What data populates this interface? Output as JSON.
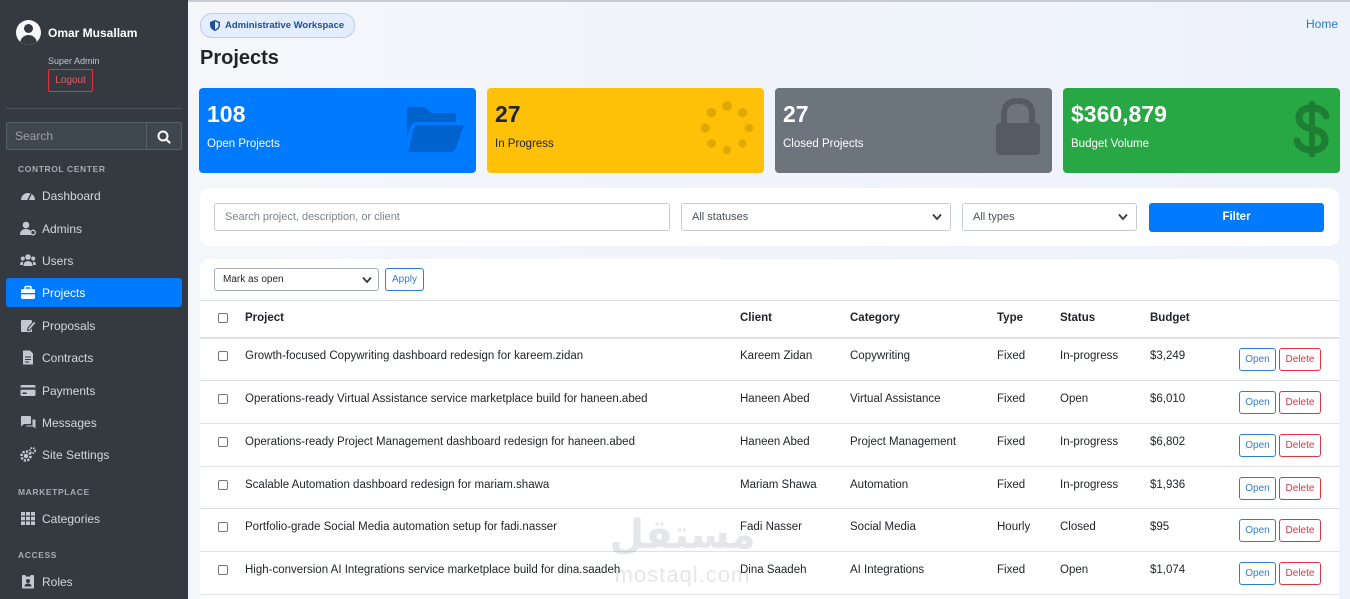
{
  "sidebar": {
    "user_name": "Omar Musallam",
    "user_role": "Super Admin",
    "logout_label": "Logout",
    "search_placeholder": "Search",
    "sections": {
      "control_center": "CONTROL CENTER",
      "marketplace": "MARKETPLACE",
      "access": "ACCESS"
    },
    "items": [
      {
        "label": "Dashboard",
        "icon": "dashboard-icon"
      },
      {
        "label": "Admins",
        "icon": "admin-user-icon"
      },
      {
        "label": "Users",
        "icon": "users-icon"
      },
      {
        "label": "Projects",
        "icon": "briefcase-icon"
      },
      {
        "label": "Proposals",
        "icon": "proposal-edit-icon"
      },
      {
        "label": "Contracts",
        "icon": "contract-file-icon"
      },
      {
        "label": "Payments",
        "icon": "credit-card-icon"
      },
      {
        "label": "Messages",
        "icon": "messages-icon"
      },
      {
        "label": "Site Settings",
        "icon": "gears-icon"
      },
      {
        "label": "Categories",
        "icon": "grid-icon"
      },
      {
        "label": "Roles",
        "icon": "roles-icon"
      }
    ],
    "active_item": "Projects"
  },
  "header": {
    "workspace_badge": "Administrative Workspace",
    "home_link": "Home",
    "page_title": "Projects"
  },
  "stats": [
    {
      "value": "108",
      "label": "Open Projects",
      "color": "#007bff",
      "icon": "folder-open-icon"
    },
    {
      "value": "27",
      "label": "In Progress",
      "color": "#ffc107",
      "icon": "spinner-icon"
    },
    {
      "value": "27",
      "label": "Closed Projects",
      "color": "#6c757d",
      "icon": "lock-icon"
    },
    {
      "value": "$360,879",
      "label": "Budget Volume",
      "color": "#28a745",
      "icon": "dollar-icon"
    }
  ],
  "filters": {
    "search_placeholder": "Search project, description, or client",
    "status_selected": "All statuses",
    "type_selected": "All types",
    "filter_label": "Filter"
  },
  "bulk": {
    "action_selected": "Mark as open",
    "apply_label": "Apply"
  },
  "table": {
    "columns": [
      "Project",
      "Client",
      "Category",
      "Type",
      "Status",
      "Budget"
    ],
    "open_label": "Open",
    "delete_label": "Delete",
    "rows": [
      {
        "project": "Growth-focused Copywriting dashboard redesign for kareem.zidan",
        "client": "Kareem Zidan",
        "category": "Copywriting",
        "type": "Fixed",
        "status": "In-progress",
        "budget": "$3,249"
      },
      {
        "project": "Operations-ready Virtual Assistance service marketplace build for haneen.abed",
        "client": "Haneen Abed",
        "category": "Virtual Assistance",
        "type": "Fixed",
        "status": "Open",
        "budget": "$6,010"
      },
      {
        "project": "Operations-ready Project Management dashboard redesign for haneen.abed",
        "client": "Haneen Abed",
        "category": "Project Management",
        "type": "Fixed",
        "status": "In-progress",
        "budget": "$6,802"
      },
      {
        "project": "Scalable Automation dashboard redesign for mariam.shawa",
        "client": "Mariam Shawa",
        "category": "Automation",
        "type": "Fixed",
        "status": "In-progress",
        "budget": "$1,936"
      },
      {
        "project": "Portfolio-grade Social Media automation setup for fadi.nasser",
        "client": "Fadi Nasser",
        "category": "Social Media",
        "type": "Hourly",
        "status": "Closed",
        "budget": "$95"
      },
      {
        "project": "High-conversion AI Integrations service marketplace build for dina.saadeh",
        "client": "Dina Saadeh",
        "category": "AI Integrations",
        "type": "Fixed",
        "status": "Open",
        "budget": "$1,074"
      }
    ]
  },
  "watermark": {
    "arabic": "مستقل",
    "latin": "mostaql.com"
  }
}
